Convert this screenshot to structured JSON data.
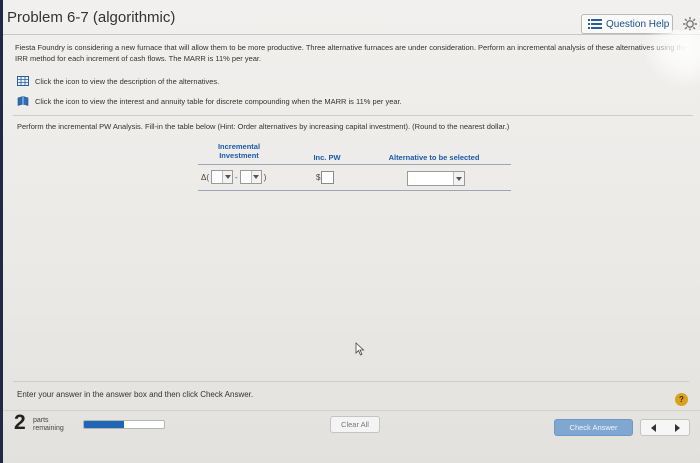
{
  "header": {
    "title": "Problem 6-7 (algorithmic)",
    "question_help": "Question Help"
  },
  "problem": {
    "intro": "Fiesta Foundry is considering a new furnace that will allow them to be more productive. Three alternative furnaces are under consideration. Perform an incremental analysis of these alternatives using the IRR method for each increment of cash flows. The MARR is 11% per year.",
    "link_description": "Click the icon to view the description of the alternatives.",
    "link_interest": "Click the icon to view the interest and annuity table for discrete compounding when the MARR is 11% per year.",
    "instruction": "Perform the incremental PW Analysis. Fill-in the table below (Hint: Order alternatives by increasing capital investment). (Round to the nearest dollar.)"
  },
  "table": {
    "col_investment": "Incremental Investment",
    "col_pw": "Inc. PW",
    "col_alt": "Alternative to be selected",
    "delta_prefix": "Δ(",
    "dash": "-",
    "close_paren": ")",
    "dollar": "$"
  },
  "footer": {
    "enter_answer": "Enter your answer in the answer box and then click Check Answer.",
    "help_symbol": "?",
    "parts_count": "2",
    "parts_label_1": "parts",
    "parts_label_2": "remaining",
    "progress": 0.5,
    "clear_all": "Clear All",
    "check_answer": "Check Answer"
  },
  "colors": {
    "accent": "#1a5aa8",
    "progress_fill": "#1f67b5",
    "check_btn": "#7fa7d2",
    "help_badge": "#d9a21b"
  },
  "icons": [
    "list-icon",
    "gear-icon",
    "table-icon",
    "book-icon",
    "mouse-cursor-icon",
    "prev-arrow-icon",
    "next-arrow-icon"
  ]
}
